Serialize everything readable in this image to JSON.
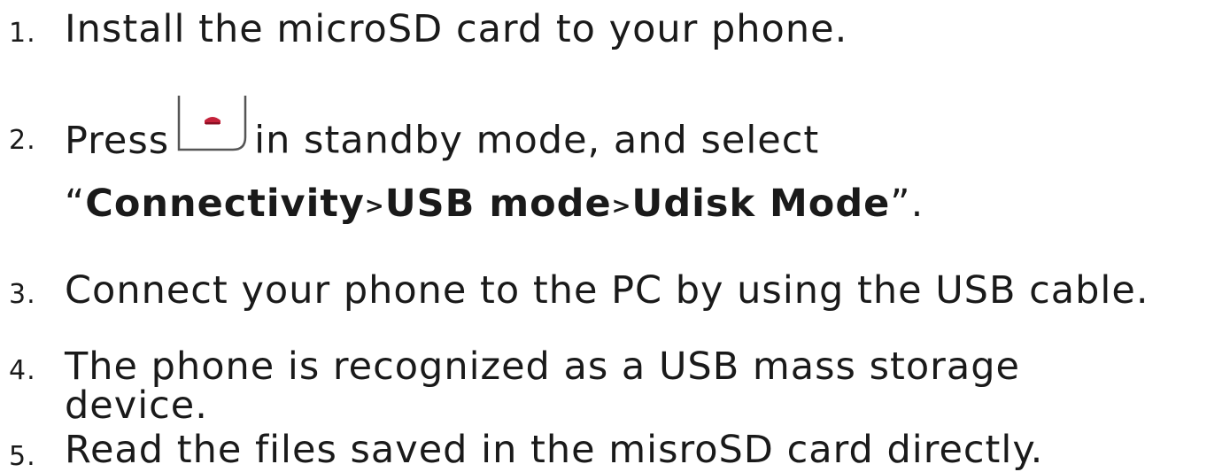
{
  "steps": [
    {
      "number": "1.",
      "text": "Install the microSD card to your phone."
    },
    {
      "number": "2.",
      "prefix": "Press",
      "icon": "phone-menu-key-icon",
      "suffix": "in standby mode, and select",
      "open_quote": "“",
      "path": [
        "Connectivity",
        "USB mode",
        "Udisk Mode"
      ],
      "separator": ">",
      "close_quote": "”."
    },
    {
      "number": "3.",
      "text": "Connect your phone to the PC by using the USB cable."
    },
    {
      "number": "4.",
      "line1": "The phone is recognized as a USB mass storage",
      "line2": "device."
    },
    {
      "number": "5.",
      "text": "Read the files saved in the misroSD card directly."
    }
  ],
  "colors": {
    "text": "#1a1a1a",
    "key_accent": "#c4213a",
    "key_outline": "#555555"
  }
}
